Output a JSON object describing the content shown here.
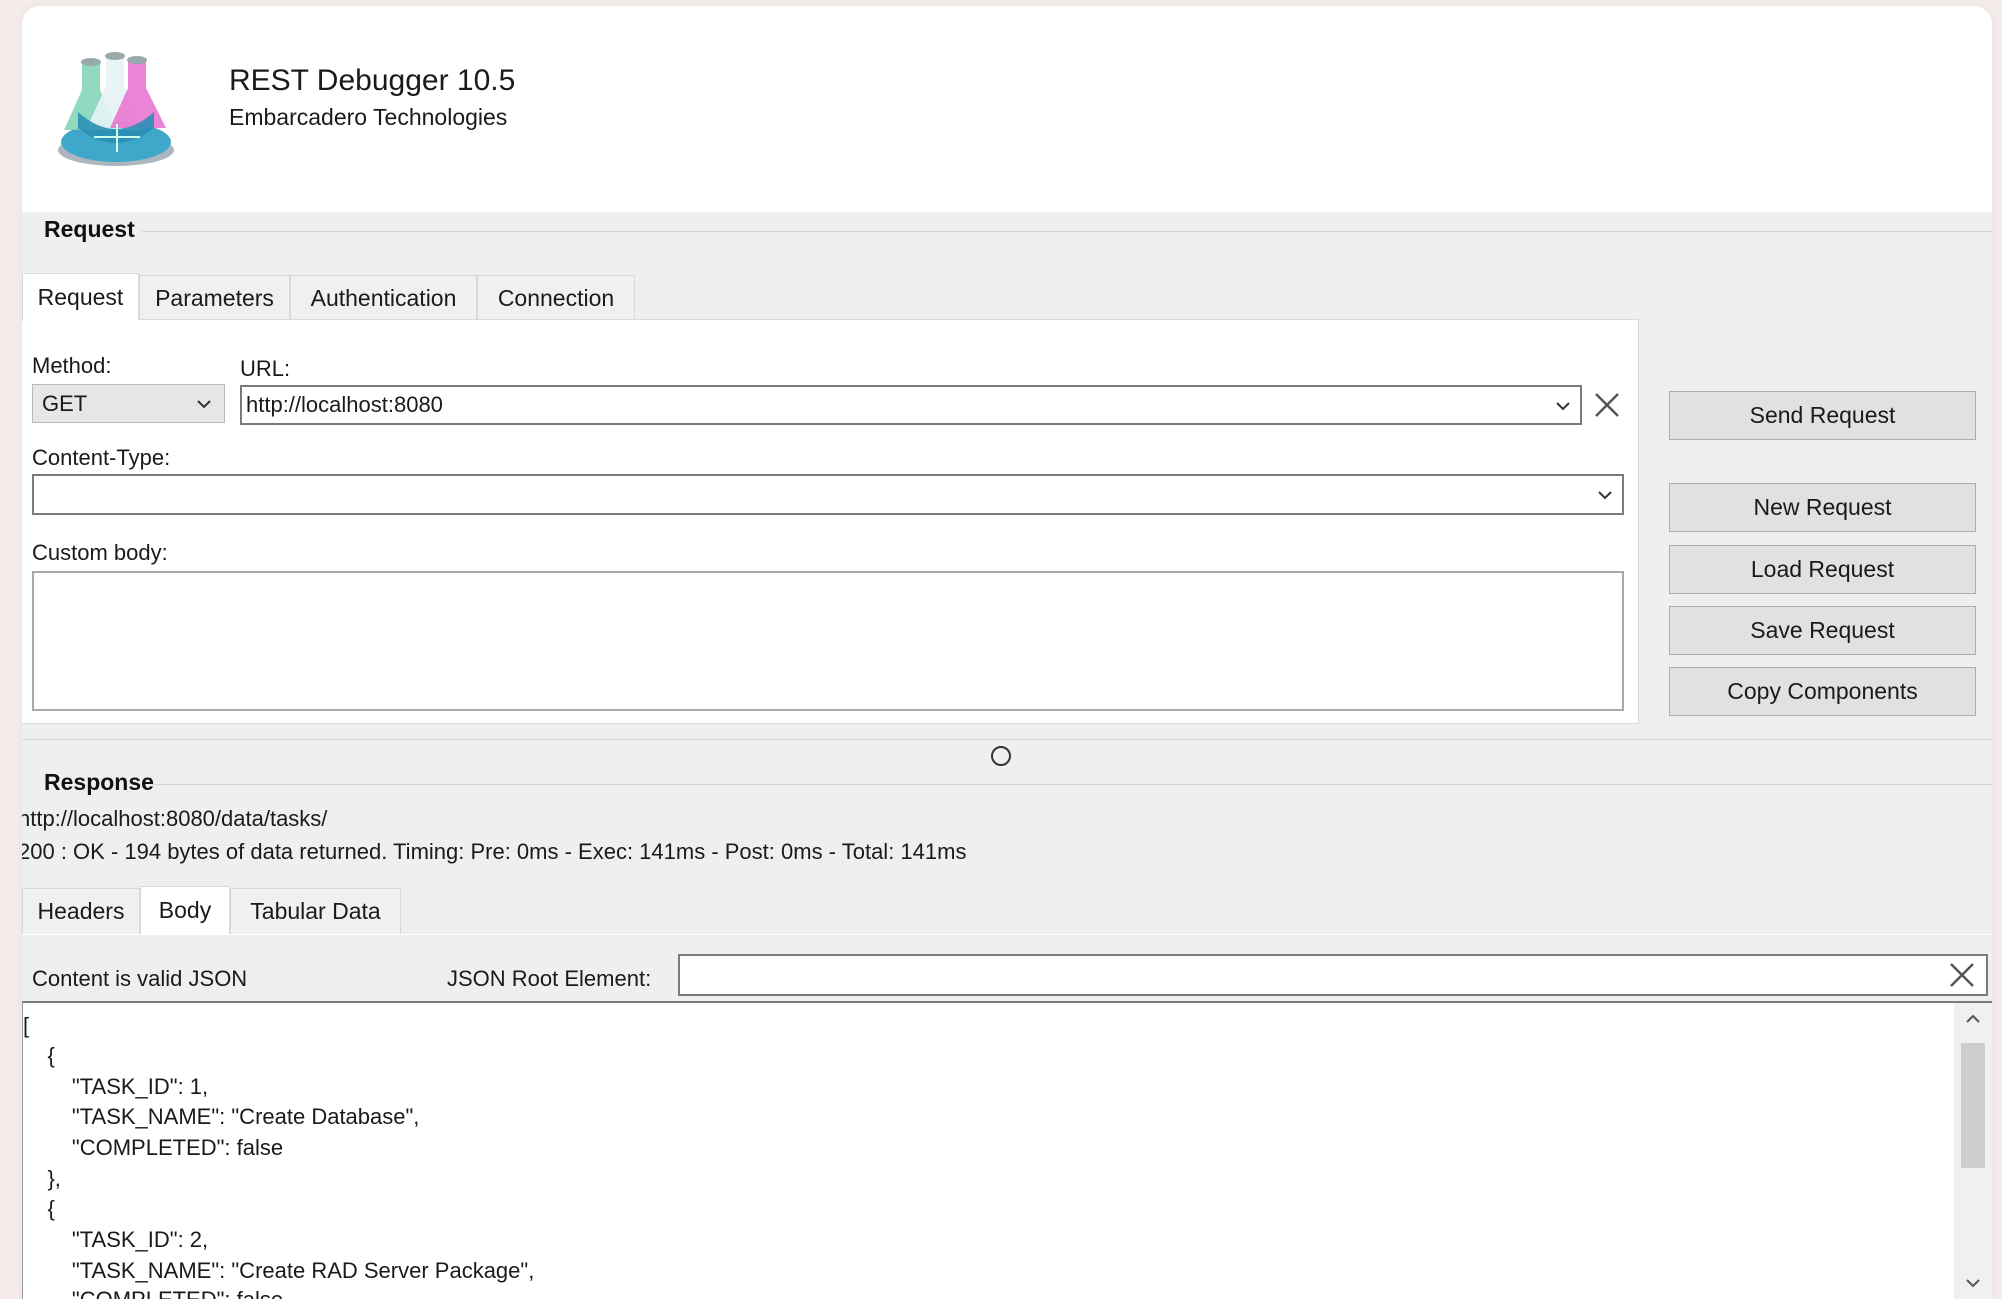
{
  "app": {
    "title": "REST Debugger 10.5",
    "company": "Embarcadero Technologies",
    "logo_icon": "flask-icon"
  },
  "request_group": {
    "label": "Request",
    "tabs": [
      "Request",
      "Parameters",
      "Authentication",
      "Connection"
    ],
    "active_tab": "Request",
    "method_label": "Method:",
    "method_value": "GET",
    "url_label": "URL:",
    "url_value": "http://localhost:8080",
    "content_type_label": "Content-Type:",
    "content_type_value": "",
    "custom_body_label": "Custom body:",
    "custom_body_value": ""
  },
  "buttons": {
    "send": "Send Request",
    "new": "New Request",
    "load": "Load Request",
    "save": "Save Request",
    "copy": "Copy Components"
  },
  "response_group": {
    "label": "Response",
    "url": "http://localhost:8080/data/tasks/",
    "status": "200 : OK - 194 bytes of data returned. Timing: Pre: 0ms - Exec: 141ms - Post: 0ms - Total: 141ms",
    "tabs": [
      "Headers",
      "Body",
      "Tabular Data"
    ],
    "active_tab": "Body",
    "valid_json_label": "Content is valid JSON",
    "json_root_label": "JSON Root Element:",
    "json_root_value": "",
    "body_lines": [
      "[",
      "    {",
      "        \"TASK_ID\": 1,",
      "        \"TASK_NAME\": \"Create Database\",",
      "        \"COMPLETED\": false",
      "    },",
      "    {",
      "        \"TASK_ID\": 2,",
      "        \"TASK_NAME\": \"Create RAD Server Package\",",
      "        \"COMPLETED\": false"
    ]
  },
  "colors": {
    "window_bg": "#efefef",
    "header_bg": "#ffffff",
    "button_bg": "#e1e1e1",
    "field_border": "#7a7a7a"
  }
}
